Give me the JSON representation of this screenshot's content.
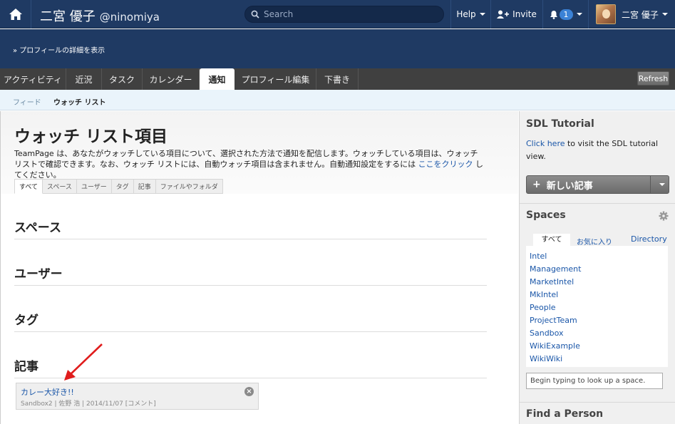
{
  "topbar": {
    "home_icon": "home-icon",
    "user_name": "二宮 優子",
    "user_handle": "@ninomiya",
    "search_placeholder": "Search",
    "help_label": "Help",
    "invite_label": "Invite",
    "notification_count": "1",
    "account_label": "二宮 優子"
  },
  "band": {
    "profile_link": "» プロフィールの詳細を表示"
  },
  "tabs": [
    "アクティビティ",
    "近況",
    "タスク",
    "カレンダー",
    "通知",
    "プロフィール編集",
    "下書き"
  ],
  "active_tab": "通知",
  "refresh_label": "Refresh",
  "subnav": {
    "feed": "フィード",
    "watchlist": "ウォッチ リスト"
  },
  "main": {
    "title": "ウォッチ リスト項目",
    "description_before": "TeamPage は、あなたがウォッチしている項目について、選択された方法で通知を配信します。ウォッチしている項目は、ウォッチ リストで確認できます。なお、ウォッチ リストには、自動ウォッチ項目は含まれません。自動通知設定をするには ",
    "description_link": "ここをクリック",
    "description_after": " してください。",
    "filter_tabs": [
      "すべて",
      "スペース",
      "ユーザー",
      "タグ",
      "記事",
      "ファイルやフォルダ"
    ],
    "sections": [
      "スペース",
      "ユーザー",
      "タグ",
      "記事"
    ],
    "article": {
      "title": "カレー大好き!!",
      "meta": "Sandbox2 | 佐野 浩 | 2014/11/07 [コメント]"
    }
  },
  "sidebar": {
    "tutorial_title": "SDL Tutorial",
    "tutorial_link": "Click here",
    "tutorial_text": " to visit the SDL tutorial view.",
    "new_article": "新しい記事",
    "spaces_title": "Spaces",
    "space_tabs": [
      "すべて",
      "お気に入り",
      "Directory"
    ],
    "spaces": [
      "Intel",
      "Management",
      "MarketIntel",
      "MkIntel",
      "People",
      "ProjectTeam",
      "Sandbox",
      "WikiExample",
      "WikiWiki"
    ],
    "space_input_placeholder": "Begin typing to look up a space.",
    "find_person_title": "Find a Person"
  },
  "colors": {
    "navy": "#1f3a63",
    "link": "#1a56a8",
    "arrow": "#e01c1c"
  }
}
